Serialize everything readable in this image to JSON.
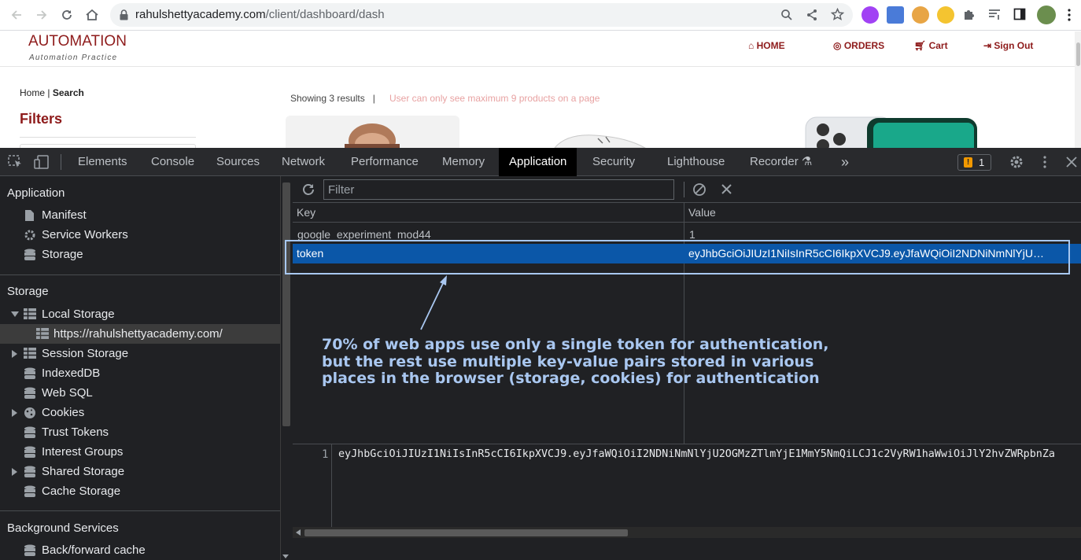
{
  "browser": {
    "url_host": "rahulshettyacademy.com",
    "url_path": "/client/dashboard/dash"
  },
  "page": {
    "brand": "AUTOMATION",
    "tagline": "Automation Practice",
    "nav": {
      "home": "HOME",
      "orders": "ORDERS",
      "cart": "Cart",
      "signout": "Sign Out"
    },
    "breadcrumb_home": "Home",
    "breadcrumb_sep": "|",
    "breadcrumb_current": "Search",
    "filters_title": "Filters",
    "results_text": "Showing 3 results",
    "results_sep": "|",
    "warning_text": "User can only see maximum 9 products on a page"
  },
  "devtools": {
    "tabs": [
      "Elements",
      "Console",
      "Sources",
      "Network",
      "Performance",
      "Memory",
      "Application",
      "Security",
      "Lighthouse",
      "Recorder"
    ],
    "active_tab": "Application",
    "more_tabs": "»",
    "issues_count": "1",
    "sidebar": {
      "application_header": "Application",
      "application_items": [
        "Manifest",
        "Service Workers",
        "Storage"
      ],
      "storage_header": "Storage",
      "local_storage": "Local Storage",
      "local_storage_origin": "https://rahulshettyacademy.com/",
      "storage_items": [
        "Session Storage",
        "IndexedDB",
        "Web SQL",
        "Cookies",
        "Trust Tokens",
        "Interest Groups",
        "Shared Storage",
        "Cache Storage"
      ],
      "background_header": "Background Services",
      "background_items": [
        "Back/forward cache"
      ]
    },
    "filter_placeholder": "Filter",
    "table": {
      "col_key": "Key",
      "col_value": "Value",
      "rows": [
        {
          "key": "google_experiment_mod44",
          "value": "1"
        },
        {
          "key": "token",
          "value": "eyJhbGciOiJIUzI1NiIsInR5cCI6IkpXVCJ9.eyJfaWQiOiI2NDNiNmNlYjU…"
        }
      ]
    },
    "annotation": "70% of web apps use only a single token for authentication, but the rest use multiple key-value pairs stored in various places in the browser (storage, cookies) for authentication",
    "editor": {
      "line_number": "1",
      "code": "eyJhbGciOiJIUzI1NiIsInR5cCI6IkpXVCJ9.eyJfaWQiOiI2NDNiNmNlYjU2OGMzZTlmYjE1MmY5NmQiLCJ1c2VyRW1haWwiOiJlY2hvZWRpbnZa"
    }
  },
  "colors": {
    "brand": "#8e1b1b",
    "selection": "#0b57a8",
    "annotation": "#a9c7f0"
  }
}
